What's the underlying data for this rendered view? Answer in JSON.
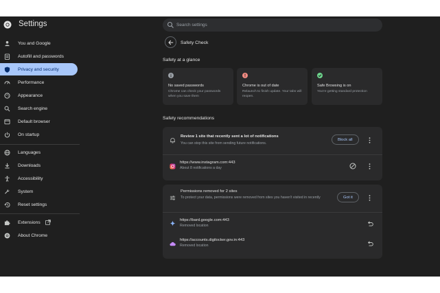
{
  "header": {
    "title": "Settings",
    "search_placeholder": "Search settings"
  },
  "sidebar": {
    "items": [
      {
        "label": "You and Google",
        "icon": "person-icon"
      },
      {
        "label": "Autofill and passwords",
        "icon": "clipboard-icon"
      },
      {
        "label": "Privacy and security",
        "icon": "shield-icon",
        "active": true
      },
      {
        "label": "Performance",
        "icon": "speedometer-icon"
      },
      {
        "label": "Appearance",
        "icon": "palette-icon"
      },
      {
        "label": "Search engine",
        "icon": "search-icon"
      },
      {
        "label": "Default browser",
        "icon": "browser-icon"
      },
      {
        "label": "On startup",
        "icon": "power-icon"
      },
      {
        "label": "Languages",
        "icon": "globe-icon"
      },
      {
        "label": "Downloads",
        "icon": "download-icon"
      },
      {
        "label": "Accessibility",
        "icon": "accessibility-icon"
      },
      {
        "label": "System",
        "icon": "wrench-icon"
      },
      {
        "label": "Reset settings",
        "icon": "history-icon"
      },
      {
        "label": "Extensions",
        "icon": "puzzle-icon"
      },
      {
        "label": "About Chrome",
        "icon": "chrome-icon"
      }
    ]
  },
  "main": {
    "page_title": "Safety Check",
    "glance_title": "Safety at a glance",
    "glance_cards": [
      {
        "title": "No saved passwords",
        "desc": "Chrome can check your passwords when you save them",
        "icon": "info-icon",
        "color": "#9aa0a6"
      },
      {
        "title": "Chrome is out of date",
        "desc": "Relaunch to finish update. Your tabs will reopen.",
        "icon": "error-icon",
        "color": "#f28b82"
      },
      {
        "title": "Safe Browsing is on",
        "desc": "You're getting standard protection",
        "icon": "check-circle-icon",
        "color": "#6dd58c"
      }
    ],
    "recommendations_title": "Safety recommendations",
    "notifications": {
      "title": "Review 1 site that recently sent a lot of notifications",
      "desc": "You can stop this site from sending future notifications.",
      "button": "Block all",
      "site": {
        "url": "https://www.instagram.com:443",
        "desc": "About 8 notifications a day"
      }
    },
    "permissions": {
      "title": "Permissions removed for 2 sites",
      "desc": "To protect your data, permissions were removed from sites you haven't visited in recently",
      "button": "Got it",
      "sites": [
        {
          "url": "https://bard.google.com:443",
          "desc": "Removed location"
        },
        {
          "url": "https://accounts.digilocker.gov.in:443",
          "desc": "Removed location"
        }
      ]
    }
  },
  "colors": {
    "background": "#1f1f1f",
    "card": "#2a2a2b",
    "accent": "#a8c7fa",
    "active_text": "#062e6f"
  }
}
